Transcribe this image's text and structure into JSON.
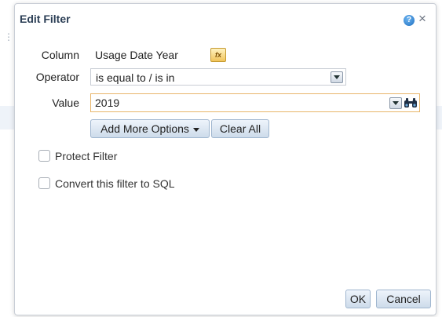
{
  "dialog": {
    "title": "Edit Filter",
    "help_icon": "help-icon",
    "close_symbol": "×"
  },
  "form": {
    "column_label": "Column",
    "column_value": "Usage Date Year",
    "operator_label": "Operator",
    "operator_value": "is equal to / is in",
    "value_label": "Value",
    "value_value": "2019"
  },
  "buttons": {
    "add_more_options": "Add More Options",
    "clear_all": "Clear All",
    "ok": "OK",
    "cancel": "Cancel"
  },
  "checkboxes": {
    "protect_filter": "Protect Filter",
    "convert_to_sql": "Convert this filter to SQL"
  },
  "colors": {
    "accent_border": "#e8b56a",
    "button_border": "#9fb6cf",
    "title": "#2b3e55"
  }
}
